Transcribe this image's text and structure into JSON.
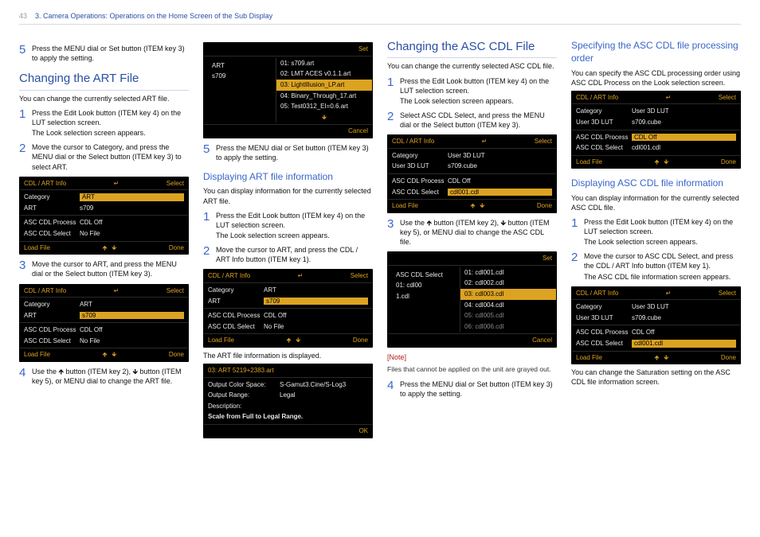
{
  "header": {
    "page_no": "43",
    "breadcrumb": "3. Camera Operations: Operations on the Home Screen of the Sub Display"
  },
  "col1": {
    "step5_top": "Press the MENU dial or Set button (ITEM key 3) to apply the setting.",
    "h2": "Changing the ART File",
    "intro": "You can change the currently selected ART file.",
    "s1": "Press the Edit Look button (ITEM key 4) on the LUT selection screen.",
    "s1b": "The Look selection screen appears.",
    "s2": "Move the cursor to Category, and press the MENU dial or the Select button (ITEM key 3) to select ART.",
    "scrA": {
      "title": "CDL / ART Info",
      "rret": "↵",
      "select": "Select",
      "rows": [
        {
          "k": "Category",
          "v": "ART",
          "sel": true
        },
        {
          "k": "ART",
          "v": "s709"
        }
      ],
      "rows2": [
        {
          "k": "ASC CDL Process",
          "v": "CDL Off"
        },
        {
          "k": "ASC CDL Select",
          "v": "No File"
        }
      ],
      "load": "Load File",
      "done": "Done"
    },
    "s3": "Move the cursor to ART, and press the MENU dial or the Select button (ITEM key 3).",
    "scrB": {
      "title": "CDL / ART Info",
      "select": "Select",
      "rows": [
        {
          "k": "Category",
          "v": "ART"
        },
        {
          "k": "ART",
          "v": "s709",
          "sel": true
        }
      ],
      "rows2": [
        {
          "k": "ASC CDL Process",
          "v": "CDL Off"
        },
        {
          "k": "ASC CDL Select",
          "v": "No File"
        }
      ],
      "load": "Load File",
      "done": "Done"
    },
    "s4": "Use the 🡹 button (ITEM key 2), 🡻 button (ITEM key 5), or MENU dial to change the ART file."
  },
  "col2": {
    "pop": {
      "left_k": "ART",
      "left_v": "s709",
      "set": "Set",
      "cancel": "Cancel",
      "opts": [
        {
          "t": "01: s709.art"
        },
        {
          "t": "02: LMT ACES v0.1.1.art"
        },
        {
          "t": "03: LightIllusion_LP.art",
          "hl": true
        },
        {
          "t": "04: Binary_Through_17.art"
        },
        {
          "t": "05: Test0312_EI=0.6.art"
        }
      ]
    },
    "s5": "Press the MENU dial or Set button (ITEM key 3) to apply the setting.",
    "h3": "Displaying ART file information",
    "intro": "You can display information for the currently selected ART file.",
    "d1": "Press the Edit Look button (ITEM key 4) on the LUT selection screen.",
    "d1b": "The Look selection screen appears.",
    "d2": "Move the cursor to ART, and press the CDL / ART Info button (ITEM key 1).",
    "scrC": {
      "title": "CDL / ART Info",
      "select": "Select",
      "rows": [
        {
          "k": "Category",
          "v": "ART"
        },
        {
          "k": "ART",
          "v": "s709",
          "sel": true
        }
      ],
      "rows2": [
        {
          "k": "ASC CDL Process",
          "v": "CDL Off"
        },
        {
          "k": "ASC CDL Select",
          "v": "No File"
        }
      ],
      "load": "Load File",
      "done": "Done"
    },
    "disp": "The ART file information is displayed.",
    "info": {
      "hdr": "03: ART 5219+2383.art",
      "r": [
        {
          "k": "Output Color Space:",
          "v": "S-Gamut3.Cine/S-Log3"
        },
        {
          "k": "Output Range:",
          "v": "Legal"
        },
        {
          "k": "Description:",
          "v": ""
        }
      ],
      "desc": "Scale from Full to Legal Range.",
      "ok": "OK"
    }
  },
  "col3": {
    "h2": "Changing the ASC CDL File",
    "intro": "You can change the currently selected ASC CDL file.",
    "s1": "Press the Edit Look button (ITEM key 4) on the LUT selection screen.",
    "s1b": "The Look selection screen appears.",
    "s2": "Select ASC CDL Select, and press the MENU dial or the Select button (ITEM key 3).",
    "scrD": {
      "title": "CDL / ART Info",
      "select": "Select",
      "rows": [
        {
          "k": "Category",
          "v": "User 3D LUT"
        },
        {
          "k": "User 3D LUT",
          "v": "s709.cube"
        }
      ],
      "rows2": [
        {
          "k": "ASC CDL Process",
          "v": "CDL Off"
        },
        {
          "k": "ASC CDL Select",
          "v": "cdl001.cdl",
          "sel": true
        }
      ],
      "load": "Load File",
      "done": "Done"
    },
    "s3": "Use the 🡹 button (ITEM key 2), 🡻 button (ITEM key 5), or MENU dial to change the ASC CDL file.",
    "pop": {
      "left_k": "ASC CDL Select",
      "left_v1": "01: cdl00",
      "left_v2": "1.cdl",
      "set": "Set",
      "cancel": "Cancel",
      "opts": [
        {
          "t": "01: cdl001.cdl"
        },
        {
          "t": "02: cdl002.cdl"
        },
        {
          "t": "03: cdl003.cdl",
          "hl": true
        },
        {
          "t": "04: cdl004.cdl"
        },
        {
          "t": "05: cdl005.cdl",
          "gr": true
        },
        {
          "t": "06: cdl006.cdl",
          "gr": true
        }
      ]
    },
    "note_l": "[Note]",
    "note_t": "Files that cannot be applied on the unit are grayed out.",
    "s4": "Press the MENU dial or Set button (ITEM key 3) to apply the setting."
  },
  "col4": {
    "h3a": "Specifying the ASC CDL file processing order",
    "pA": "You can specify the ASC CDL processing order using ASC CDL Process on the Look selection screen.",
    "scrE": {
      "title": "CDL / ART Info",
      "select": "Select",
      "rows": [
        {
          "k": "Category",
          "v": "User 3D LUT"
        },
        {
          "k": "User 3D LUT",
          "v": "s709.cube"
        }
      ],
      "rows2": [
        {
          "k": "ASC CDL Process",
          "v": "CDL Off",
          "sel": true
        },
        {
          "k": "ASC CDL Select",
          "v": "cdl001.cdl"
        }
      ],
      "load": "Load File",
      "done": "Done"
    },
    "h3b": "Displaying ASC CDL file information",
    "pB": "You can display information for the currently selected ASC CDL file.",
    "b1": "Press the Edit Look button (ITEM key 4) on the LUT selection screen.",
    "b1b": "The Look selection screen appears.",
    "b2": "Move the cursor to ASC CDL Select, and press the CDL / ART Info button (ITEM key 1).",
    "b2b": "The ASC CDL file information screen appears.",
    "scrF": {
      "title": "CDL / ART Info",
      "select": "Select",
      "rows": [
        {
          "k": "Category",
          "v": "User 3D LUT"
        },
        {
          "k": "User 3D LUT",
          "v": "s709.cube"
        }
      ],
      "rows2": [
        {
          "k": "ASC CDL Process",
          "v": "CDL Off"
        },
        {
          "k": "ASC CDL Select",
          "v": "cdl001.cdl",
          "sel": true
        }
      ],
      "load": "Load File",
      "done": "Done"
    },
    "pC": "You can change the Saturation setting on the ASC CDL file information screen."
  },
  "glyph": {
    "up": "🡹",
    "down": "🡻",
    "ret": "↵"
  }
}
